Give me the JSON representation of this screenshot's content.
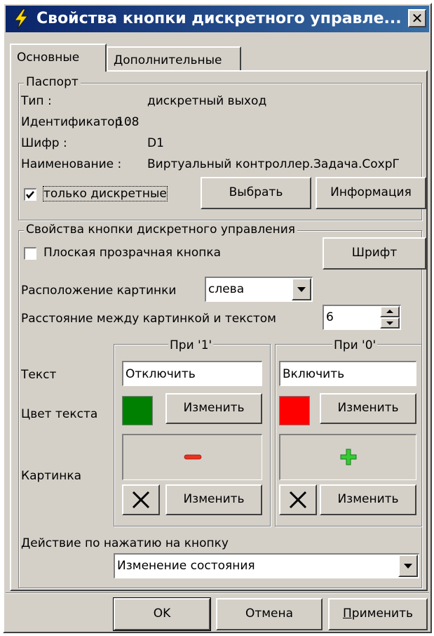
{
  "window": {
    "title": "Свойства кнопки дискретного управле...",
    "close_glyph": "✕"
  },
  "tabs": [
    {
      "label": "Основные",
      "active": true
    },
    {
      "label": "Дополнительные",
      "active": false
    }
  ],
  "passport": {
    "legend": "Паспорт",
    "rows": [
      {
        "label": "Тип :",
        "value": "дискретный выход"
      },
      {
        "label": "Идентификатор :",
        "value": "108"
      },
      {
        "label": "Шифр :",
        "value": "D1"
      },
      {
        "label": "Наименование :",
        "value": "Виртуальный контроллер.Задача.СохрГ"
      }
    ],
    "only_discrete": {
      "label": "только дискретные",
      "checked": true
    },
    "select_button": "Выбрать",
    "info_button": "Информация"
  },
  "props": {
    "legend": "Свойства кнопки дискретного управления",
    "flat_transparent": {
      "label": "Плоская прозрачная кнопка",
      "checked": false
    },
    "font_button": "Шрифт",
    "image_position_label": "Расположение картинки",
    "image_position_value": "слева",
    "spacing_label": "Расстояние между картинкой и текстом",
    "spacing_value": "6",
    "row_labels": {
      "text": "Текст",
      "text_color": "Цвет текста",
      "image": "Картинка"
    },
    "state1": {
      "header": "При '1'",
      "text": "Отключить",
      "color": "#008000",
      "change_color_button": "Изменить",
      "image_glyph": "minus",
      "image_color": "#e8321e",
      "change_image_button": "Изменить"
    },
    "state0": {
      "header": "При '0'",
      "text": "Включить",
      "color": "#ff0000",
      "change_color_button": "Изменить",
      "image_glyph": "plus",
      "image_color": "#33cc33",
      "change_image_button": "Изменить"
    },
    "action_label": "Действие по нажатию на кнопку",
    "action_value": "Изменение состояния"
  },
  "footer": {
    "ok": "OK",
    "cancel": "Отмена",
    "apply": "Применить"
  }
}
